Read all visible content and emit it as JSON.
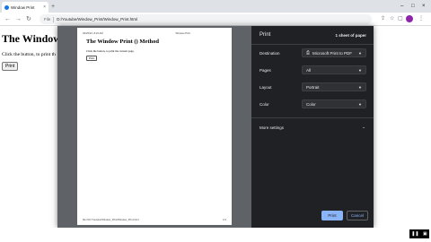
{
  "browser": {
    "tab_title": "Window Print",
    "tab_close": "×",
    "new_tab": "+",
    "window_controls": {
      "minimize": "–",
      "maximize": "□",
      "close": "×"
    },
    "nav": {
      "back": "←",
      "forward": "→",
      "reload": "↻"
    },
    "address_label": "File",
    "url": "D:/Youtube/Window_Print/Window_Print.html",
    "icons": [
      "share-icon",
      "star-icon",
      "extensions-icon",
      "profile-avatar",
      "menu-icon"
    ],
    "colors": {
      "tabbar": "#dee1e6",
      "accent": "#1a73e8"
    }
  },
  "page": {
    "heading": "The Window",
    "text": "Click the button, to print th",
    "print_button": "Print"
  },
  "preview": {
    "date": "03/25/22, 8:16 AM",
    "tab_title": "Window Print",
    "heading": "The Window Print () Method",
    "text": "Click the button, to print the current page.",
    "button": "Print",
    "footer_path": "file:///D:/Youtube/Window_Print/Window_Print.html",
    "footer_page": "1/1"
  },
  "settings": {
    "title": "Print",
    "sheet_count": "1 sheet of paper",
    "destination": {
      "label": "Destination",
      "value": "Microsoft Print to PDF"
    },
    "pages": {
      "label": "Pages",
      "value": "All"
    },
    "layout": {
      "label": "Layout",
      "value": "Portrait"
    },
    "color": {
      "label": "Color",
      "value": "Color"
    },
    "more_settings": "More settings",
    "print_button": "Print",
    "cancel_button": "Cancel",
    "colors": {
      "panel_bg": "#202124",
      "button_blue": "#8ab4f8"
    }
  },
  "video_controls": {
    "pause": "❚❚",
    "fullscreen": "▣"
  }
}
